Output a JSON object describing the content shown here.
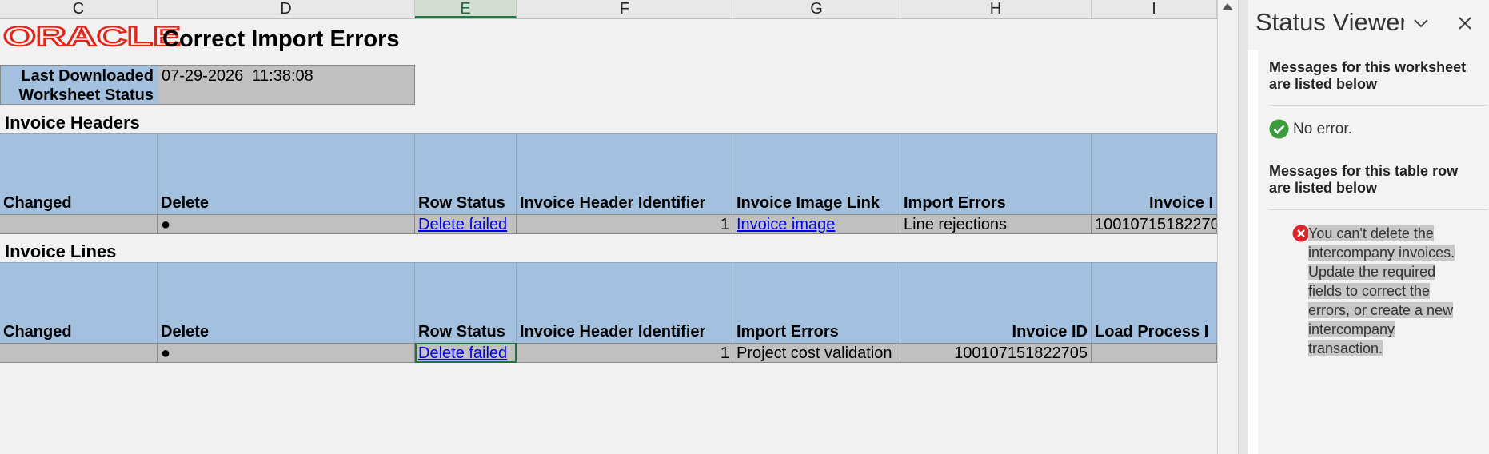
{
  "columns": [
    {
      "letter": "C"
    },
    {
      "letter": "D"
    },
    {
      "letter": "E",
      "active": true
    },
    {
      "letter": "F"
    },
    {
      "letter": "G"
    },
    {
      "letter": "H"
    },
    {
      "letter": "I"
    }
  ],
  "logo": "ORACLE",
  "title": "Correct Import Errors",
  "status": {
    "label_line1": "Last Downloaded",
    "label_line2": "Worksheet Status",
    "value": "07-29-2026  11:38:08"
  },
  "headers_section": {
    "title": "Invoice Headers",
    "columns": [
      "Changed",
      "Delete",
      "Row Status",
      "Invoice Header Identifier",
      "Invoice Image Link",
      "Import Errors",
      "Invoice I"
    ],
    "row": {
      "changed": "",
      "delete": "●",
      "row_status": "Delete failed",
      "identifier": "1",
      "image_link": "Invoice image",
      "import_errors": "Line rejections",
      "invoice_id": "10010715182270"
    }
  },
  "lines_section": {
    "title": "Invoice Lines",
    "columns": [
      "Changed",
      "Delete",
      "Row Status",
      "Invoice Header Identifier",
      "Import Errors",
      "Invoice ID",
      "Load Process I"
    ],
    "row": {
      "changed": "",
      "delete": "●",
      "row_status": "Delete failed",
      "identifier": "1",
      "import_errors": "Project cost validation",
      "invoice_id": "100107151822705",
      "load_process": ""
    }
  },
  "pane": {
    "title": "Status Viewer",
    "worksheet_heading": "Messages for this worksheet are listed below",
    "no_error": "No error.",
    "row_heading": "Messages for this table row are listed below",
    "error_message": "You can't delete the intercompany invoices. Update the required fields to correct the errors, or create a new intercompany transaction."
  },
  "colors": {
    "header_fill": "#a3c0de",
    "data_fill": "#c0c0c0",
    "oracle_red": "#e1251b",
    "success_green": "#3c9b3c",
    "error_red": "#d9262b"
  },
  "icons": [
    "oracle-logo",
    "chevron-down-icon",
    "close-icon",
    "success-check-icon",
    "error-x-icon",
    "scroll-up-arrow-icon"
  ]
}
